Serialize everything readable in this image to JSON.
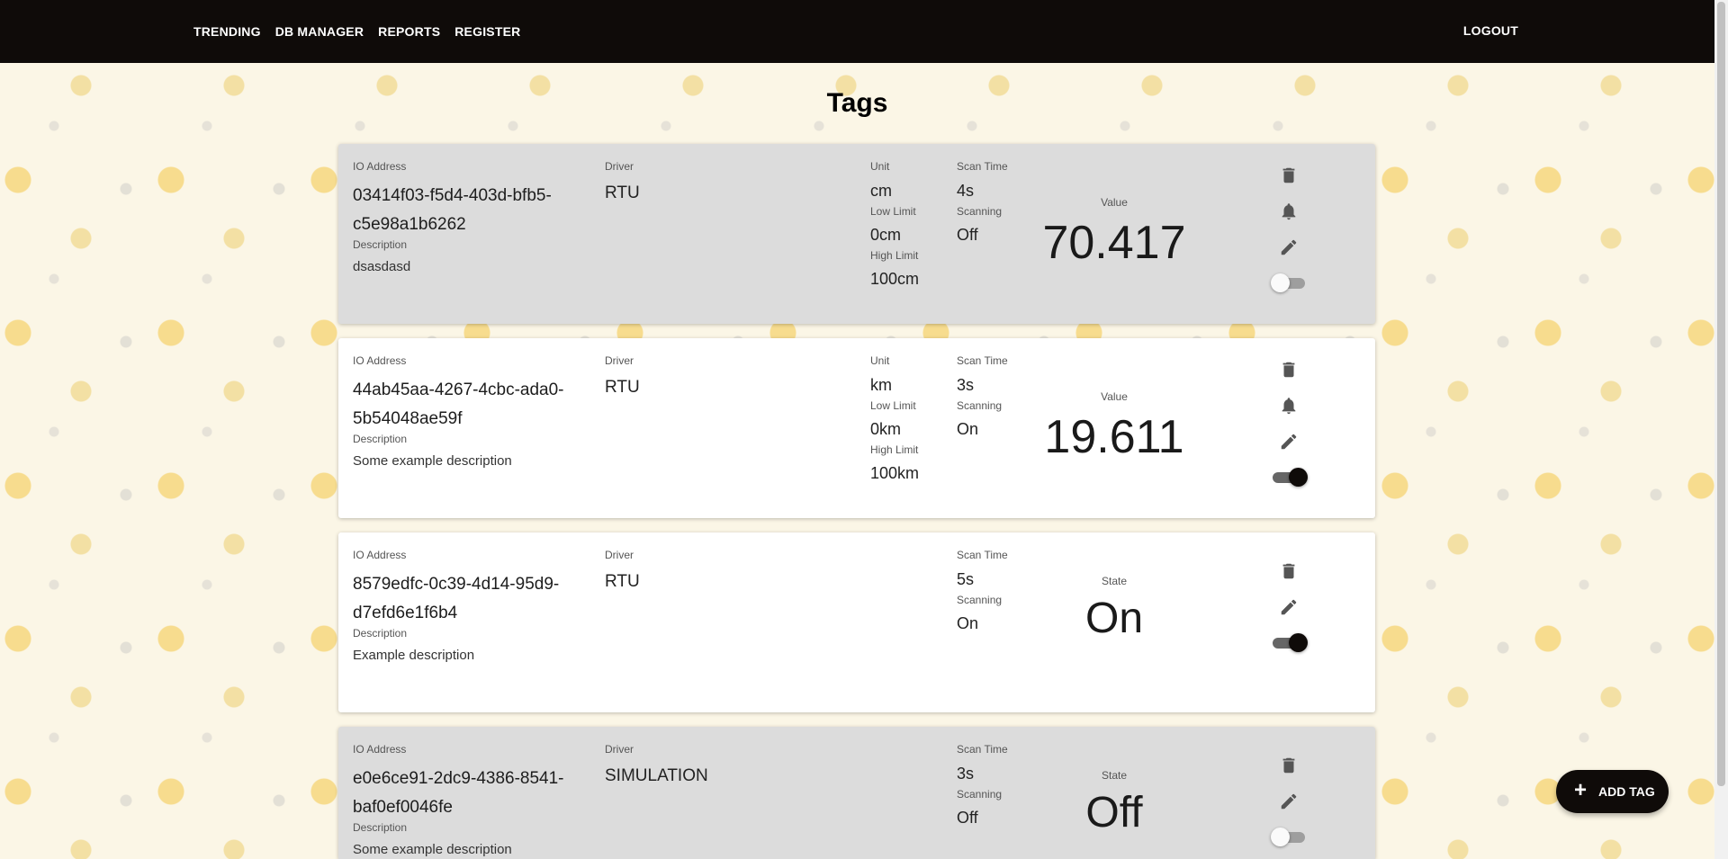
{
  "nav": {
    "links": [
      "TRENDING",
      "DB MANAGER",
      "REPORTS",
      "REGISTER"
    ],
    "logout": "LOGOUT"
  },
  "page": {
    "title": "Tags"
  },
  "labels": {
    "io_address": "IO Address",
    "driver": "Driver",
    "description": "Description",
    "unit": "Unit",
    "low_limit": "Low Limit",
    "high_limit": "High Limit",
    "scan_time": "Scan Time",
    "scanning": "Scanning",
    "value": "Value",
    "state": "State"
  },
  "tags": [
    {
      "io_address": "03414f03-f5d4-403d-bfb5-c5e98a1b6262",
      "driver": "RTU",
      "description": "dsasdasd",
      "unit": "cm",
      "low_limit": "0cm",
      "high_limit": "100cm",
      "scan_time": "4s",
      "scanning": "Off",
      "value": "70.417",
      "toggle_on": false,
      "bg": "gray"
    },
    {
      "io_address": "44ab45aa-4267-4cbc-ada0-5b54048ae59f",
      "driver": "RTU",
      "description": "Some example description",
      "unit": "km",
      "low_limit": "0km",
      "high_limit": "100km",
      "scan_time": "3s",
      "scanning": "On",
      "value": "19.611",
      "toggle_on": true,
      "bg": "white"
    },
    {
      "io_address": "8579edfc-0c39-4d14-95d9-d7efd6e1f6b4",
      "driver": "RTU",
      "description": "Example description",
      "scan_time": "5s",
      "scanning": "On",
      "state": "On",
      "toggle_on": true,
      "bg": "white"
    },
    {
      "io_address": "e0e6ce91-2dc9-4386-8541-baf0ef0046fe",
      "driver": "SIMULATION",
      "description": "Some example description",
      "scan_time": "3s",
      "scanning": "Off",
      "state": "Off",
      "toggle_on": false,
      "bg": "gray"
    }
  ],
  "fab": {
    "label": "ADD TAG",
    "icon": "plus-icon"
  },
  "colors": {
    "navbar": "#0f0b09",
    "card_gray": "#dcdcdc",
    "card_white": "#ffffff"
  }
}
